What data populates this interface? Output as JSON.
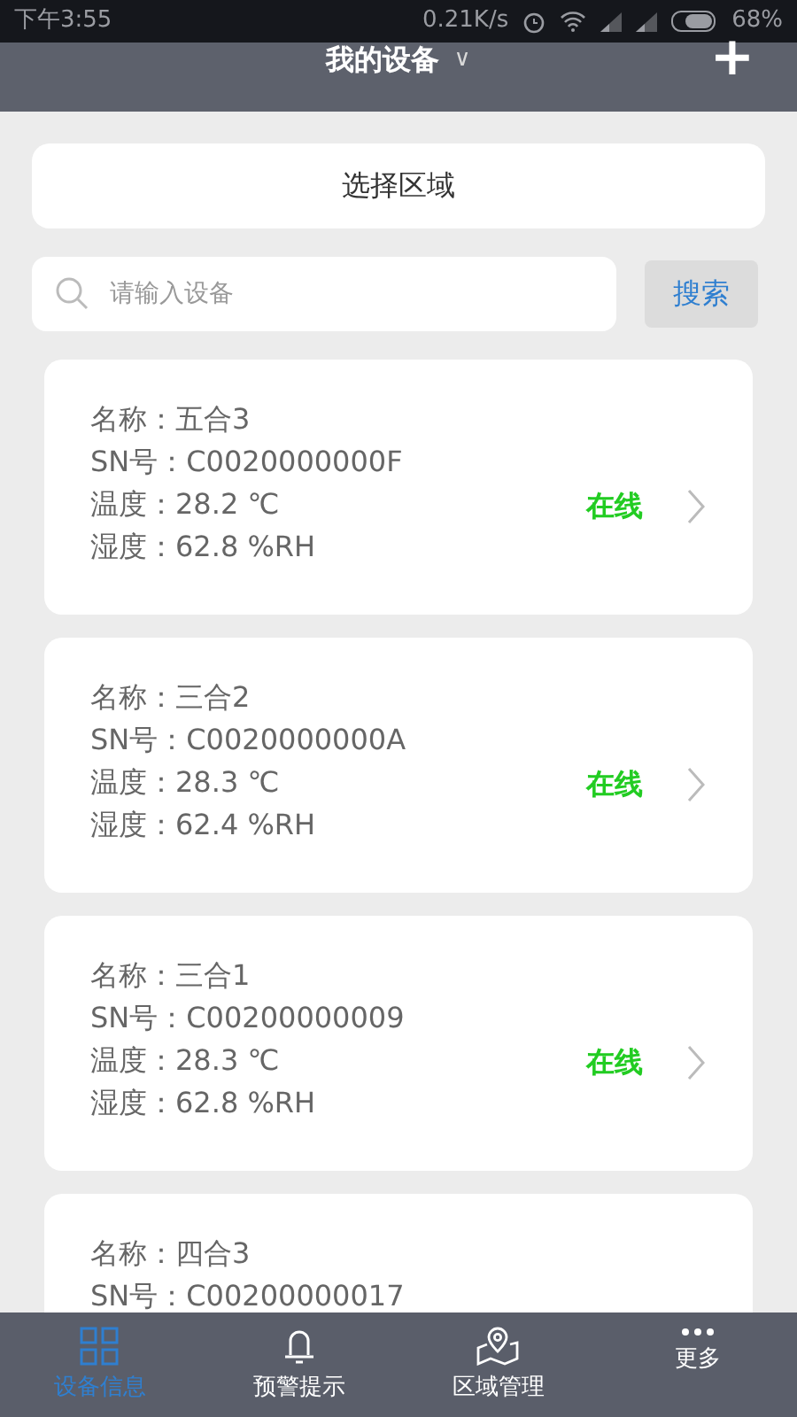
{
  "status_bar": {
    "time": "下午3:55",
    "speed": "0.21K/s",
    "battery": "68%"
  },
  "header": {
    "title": "我的设备",
    "dropdown": "∨",
    "add": "+"
  },
  "area_select": {
    "label": "选择区域"
  },
  "search": {
    "placeholder": "请输入设备",
    "button": "搜索"
  },
  "devices": [
    {
      "name": "名称：五合3",
      "sn": "SN号：C0020000000F",
      "temperature": "温度：28.2 ℃",
      "humidity": "湿度：62.8 %RH",
      "status": "在线",
      "online": true
    },
    {
      "name": "名称：三合2",
      "sn": "SN号：C0020000000A",
      "temperature": "温度：28.3 ℃",
      "humidity": "湿度：62.4 %RH",
      "status": "在线",
      "online": true
    },
    {
      "name": "名称：三合1",
      "sn": "SN号：C00200000009",
      "temperature": "温度：28.3 ℃",
      "humidity": "湿度：62.8 %RH",
      "status": "在线",
      "online": true
    },
    {
      "name": "名称：四合3",
      "sn": "SN号：C00200000017"
    }
  ],
  "tabs": [
    {
      "label": "设备信息",
      "kind": "grid",
      "selected": true
    },
    {
      "label": "预警提示",
      "kind": "bell",
      "selected": false
    },
    {
      "label": "区域管理",
      "kind": "map",
      "selected": false
    },
    {
      "label": "更多",
      "kind": "more",
      "selected": false
    }
  ]
}
